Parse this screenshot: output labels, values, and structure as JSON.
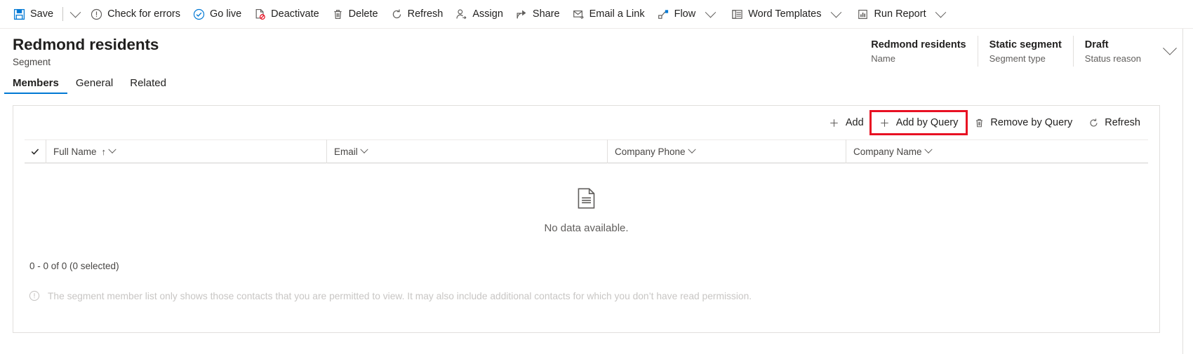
{
  "command_bar": {
    "items": [
      {
        "label": "Save",
        "icon": "save-icon",
        "has_caret": false
      },
      {
        "label": "",
        "icon": "caret-only",
        "has_caret": true
      },
      {
        "label": "Check for errors",
        "icon": "exclamation-circle-icon",
        "has_caret": false
      },
      {
        "label": "Go live",
        "icon": "checkmark-circle-icon",
        "has_caret": false
      },
      {
        "label": "Deactivate",
        "icon": "deactivate-page-icon",
        "has_caret": false
      },
      {
        "label": "Delete",
        "icon": "trash-icon",
        "has_caret": false
      },
      {
        "label": "Refresh",
        "icon": "refresh-icon",
        "has_caret": false
      },
      {
        "label": "Assign",
        "icon": "assign-person-icon",
        "has_caret": false
      },
      {
        "label": "Share",
        "icon": "share-icon",
        "has_caret": false
      },
      {
        "label": "Email a Link",
        "icon": "email-link-icon",
        "has_caret": false
      },
      {
        "label": "Flow",
        "icon": "flow-icon",
        "has_caret": true
      },
      {
        "label": "Word Templates",
        "icon": "word-template-icon",
        "has_caret": true
      },
      {
        "label": "Run Report",
        "icon": "report-chart-icon",
        "has_caret": true
      }
    ]
  },
  "header": {
    "title": "Redmond residents",
    "subtitle": "Segment",
    "facts": [
      {
        "value": "Redmond residents",
        "label": "Name"
      },
      {
        "value": "Static segment",
        "label": "Segment type"
      },
      {
        "value": "Draft",
        "label": "Status reason"
      }
    ]
  },
  "tabs": [
    {
      "label": "Members",
      "active": true
    },
    {
      "label": "General",
      "active": false
    },
    {
      "label": "Related",
      "active": false
    }
  ],
  "grid": {
    "commands": [
      {
        "label": "Add",
        "icon": "plus-icon",
        "highlighted": false
      },
      {
        "label": "Add by Query",
        "icon": "plus-icon",
        "highlighted": true
      },
      {
        "label": "Remove by Query",
        "icon": "trash-icon",
        "highlighted": false
      },
      {
        "label": "Refresh",
        "icon": "refresh-icon",
        "highlighted": false
      }
    ],
    "columns": [
      {
        "label": "Full Name",
        "sorted": true,
        "sort_arrow": "↑"
      },
      {
        "label": "Email",
        "sorted": false,
        "sort_arrow": ""
      },
      {
        "label": "Company Phone",
        "sorted": false,
        "sort_arrow": ""
      },
      {
        "label": "Company Name",
        "sorted": false,
        "sort_arrow": ""
      }
    ],
    "rows": [],
    "empty_message": "No data available.",
    "empty_icon": "document-page-icon",
    "row_count_text": "0 - 0 of 0 (0 selected)",
    "notice_text": "The segment member list only shows those contacts that you are permitted to view. It may also include additional contacts for which you don’t have read permission.",
    "notice_icon": "info-circle-icon"
  },
  "colors": {
    "accent": "#0078d4",
    "highlight": "#e81123",
    "text": "#201f1e",
    "muted": "#605e5c",
    "border": "#e1dfdd"
  }
}
